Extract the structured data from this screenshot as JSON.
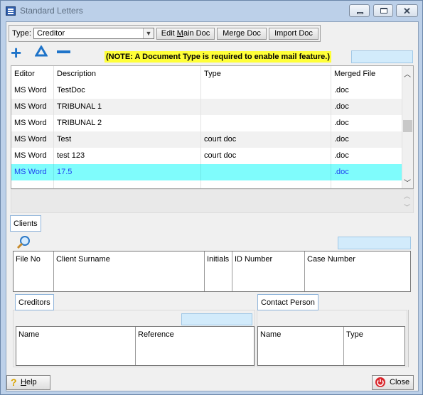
{
  "window": {
    "title": "Standard Letters"
  },
  "toolbar": {
    "type_label": "Type:",
    "type_value": "Creditor",
    "edit_main_doc_prefix": "Edit ",
    "edit_main_doc_mnemonic": "M",
    "edit_main_doc_suffix": "ain Doc",
    "merge_doc": "Merge Doc",
    "import_doc": "Import Doc"
  },
  "actions": {
    "add_icon": "plus-icon",
    "up_icon": "triangle-up-icon",
    "remove_icon": "minus-icon",
    "note": "(NOTE: A Document  Type is required to enable mail feature.)"
  },
  "letters": {
    "columns": [
      "Editor",
      "Description",
      "Type",
      "Merged File"
    ],
    "rows": [
      {
        "editor": "MS Word",
        "description": "TestDoc",
        "type": "",
        "merged_file": ".doc"
      },
      {
        "editor": "MS Word",
        "description": "TRIBUNAL 1",
        "type": "",
        "merged_file": ".doc"
      },
      {
        "editor": "MS Word",
        "description": "TRIBUNAL 2",
        "type": "",
        "merged_file": ".doc"
      },
      {
        "editor": "MS Word",
        "description": "Test",
        "type": "court doc",
        "merged_file": ".doc"
      },
      {
        "editor": "MS Word",
        "description": "test 123",
        "type": "court doc",
        "merged_file": ".doc"
      },
      {
        "editor": "MS Word",
        "description": "17.5",
        "type": "",
        "merged_file": ".doc"
      }
    ],
    "selected_index": 5
  },
  "clients": {
    "tab_label": "Clients",
    "search_icon": "magnifier-icon",
    "columns": [
      "File No",
      "Client Surname",
      "Initials",
      "ID Number",
      "Case Number"
    ]
  },
  "creditors": {
    "tab_label": "Creditors",
    "columns": [
      "Name",
      "Reference"
    ]
  },
  "contact_person": {
    "tab_label": "Contact Person",
    "columns": [
      "Name",
      "Type"
    ]
  },
  "footer": {
    "help_mnemonic": "H",
    "help_rest": "elp",
    "close": "Close"
  },
  "colors": {
    "selected_row": "#7ffcfc",
    "note_highlight": "#ffff38",
    "accent_blue": "#1f74c9"
  }
}
